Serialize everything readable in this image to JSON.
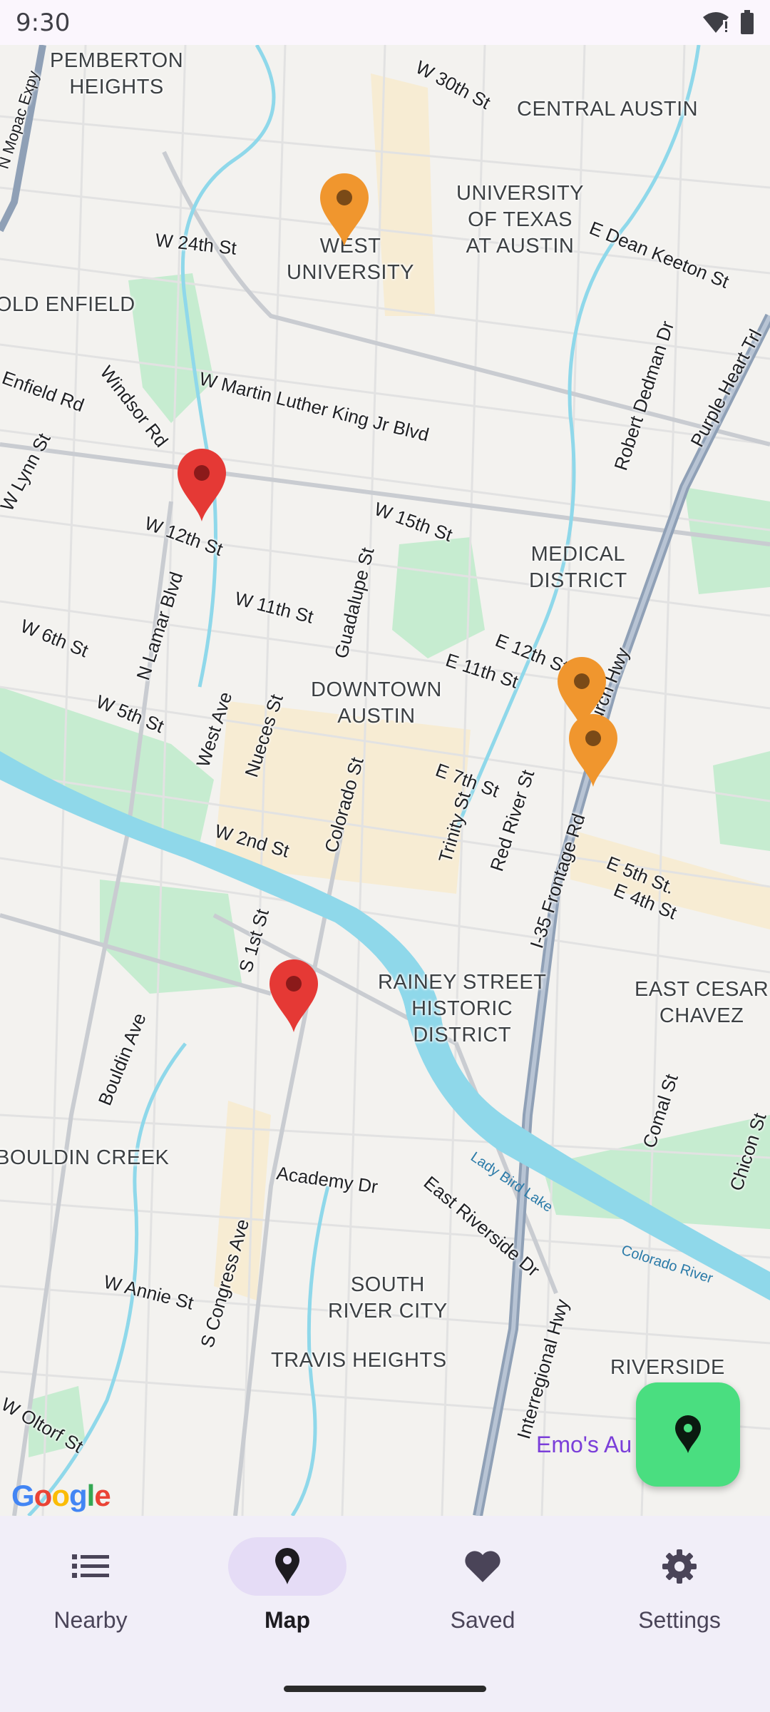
{
  "status_bar": {
    "time": "9:30"
  },
  "map": {
    "neighborhoods": [
      "PEMBERTON\nHEIGHTS",
      "CENTRAL AUSTIN",
      "UNIVERSITY\nOF TEXAS\nAT AUSTIN",
      "WEST\nUNIVERSITY",
      "OLD ENFIELD",
      "MEDICAL\nDISTRICT",
      "DOWNTOWN\nAUSTIN",
      "RAINEY STREET\nHISTORIC\nDISTRICT",
      "EAST CESAR\nCHAVEZ",
      "BOULDIN CREEK",
      "SOUTH\nRIVER CITY",
      "TRAVIS HEIGHTS",
      "RIVERSIDE"
    ],
    "streets": [
      "W 30th St",
      "N Mopac Expy",
      "W 24th St",
      "E Dean Keeton St",
      "Robert Dedman Dr",
      "Purple Heart Trl",
      "W Martin Luther King Jr Blvd",
      "Enfield Rd",
      "Windsor Rd",
      "W Lynn St",
      "W 15th St",
      "W 12th St",
      "W 11th St",
      "Guadalupe St",
      "N Lamar Blvd",
      "W 6th St",
      "W 5th St",
      "E 12th St",
      "E 11th St",
      "Church Hwy",
      "West Ave",
      "Nueces St",
      "Colorado St",
      "E 7th St",
      "Trinity St",
      "Red River St",
      "I-35 Frontage Rd",
      "W 2nd St",
      "E 5th St.",
      "E 4th St",
      "S 1st St",
      "Bouldin Ave",
      "Comal St",
      "Chicon St",
      "Academy Dr",
      "East Riverside Dr",
      "W Annie St",
      "S Congress Ave",
      "Interregional Hwy",
      "W Oltorf St"
    ],
    "water": [
      "Lady Bird Lake",
      "Colorado River"
    ],
    "poi": "Emo's Au",
    "attribution": "Google",
    "colors": {
      "pin_red": "#e53935",
      "pin_orange": "#f0962e",
      "water": "#8fd8ea",
      "park": "#c6ecd0"
    }
  },
  "fab": {
    "icon": "location-pin-icon"
  },
  "bottom_nav": {
    "items": [
      {
        "label": "Nearby",
        "icon": "list-icon",
        "active": false
      },
      {
        "label": "Map",
        "icon": "location-pin-icon",
        "active": true
      },
      {
        "label": "Saved",
        "icon": "heart-icon",
        "active": false
      },
      {
        "label": "Settings",
        "icon": "gear-icon",
        "active": false
      }
    ]
  }
}
